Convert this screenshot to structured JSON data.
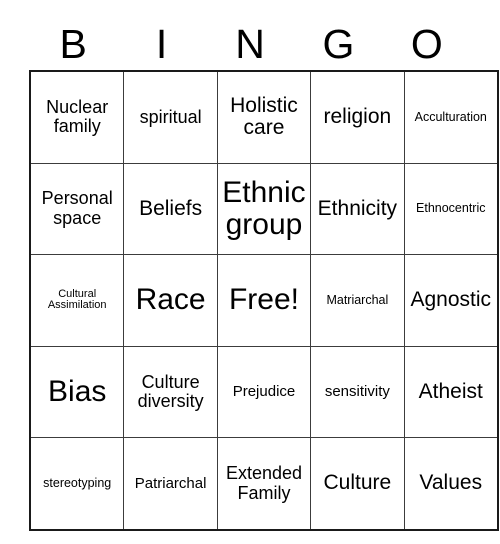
{
  "card": {
    "header_letters": [
      "B",
      "I",
      "N",
      "G",
      "O"
    ],
    "rows": [
      [
        {
          "text": "Nuclear family",
          "size": "l"
        },
        {
          "text": "spiritual",
          "size": "l"
        },
        {
          "text": "Holistic care",
          "size": "xl"
        },
        {
          "text": "religion",
          "size": "xl"
        },
        {
          "text": "Acculturation",
          "size": "s"
        }
      ],
      [
        {
          "text": "Personal space",
          "size": "l"
        },
        {
          "text": "Beliefs",
          "size": "xl"
        },
        {
          "text": "Ethnic group",
          "size": "xxl"
        },
        {
          "text": "Ethnicity",
          "size": "xl"
        },
        {
          "text": "Ethnocentric",
          "size": "s"
        }
      ],
      [
        {
          "text": "Cultural Assimilation",
          "size": "xs"
        },
        {
          "text": "Race",
          "size": "xxl"
        },
        {
          "text": "Free!",
          "size": "xxl"
        },
        {
          "text": "Matriarchal",
          "size": "s"
        },
        {
          "text": "Agnostic",
          "size": "xl"
        }
      ],
      [
        {
          "text": "Bias",
          "size": "xxl"
        },
        {
          "text": "Culture diversity",
          "size": "l"
        },
        {
          "text": "Prejudice",
          "size": "m"
        },
        {
          "text": "sensitivity",
          "size": "m"
        },
        {
          "text": "Atheist",
          "size": "xl"
        }
      ],
      [
        {
          "text": "stereotyping",
          "size": "s"
        },
        {
          "text": "Patriarchal",
          "size": "m"
        },
        {
          "text": "Extended Family",
          "size": "l"
        },
        {
          "text": "Culture",
          "size": "xl"
        },
        {
          "text": "Values",
          "size": "xl"
        }
      ]
    ]
  },
  "colors": {
    "background": "#ffffff",
    "text": "#000000",
    "grid_line": "#3c3c3c",
    "grid_border": "#1a1a1a"
  }
}
